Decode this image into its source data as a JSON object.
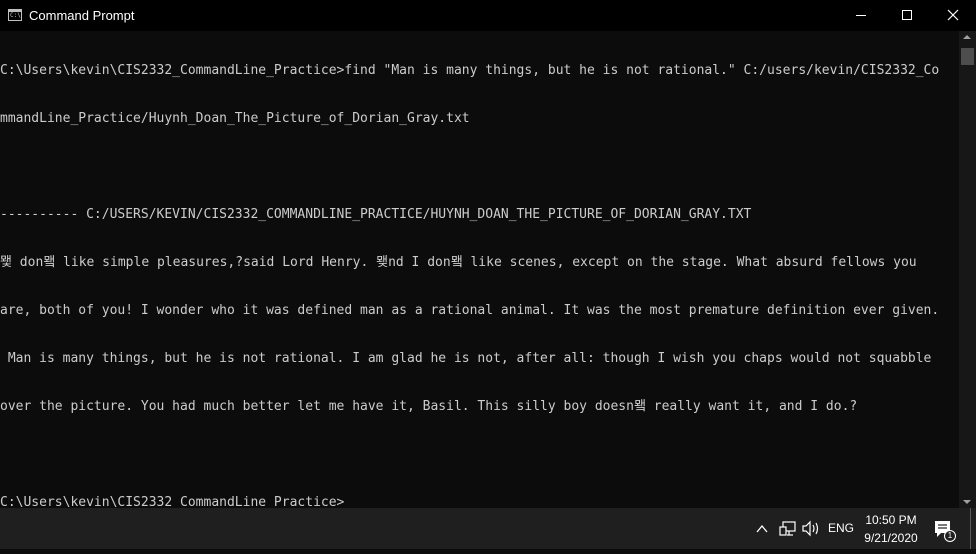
{
  "window": {
    "title": "Command Prompt",
    "app_icon_text": "C:\\",
    "icon": "cmd-icon"
  },
  "console": {
    "lines": [
      "C:\\Users\\kevin\\CIS2332_CommandLine_Practice>find \"Man is many things, but he is not rational.\" C:/users/kevin/CIS2332_Co",
      "mmandLine_Practice/Huynh_Doan_The_Picture_of_Dorian_Gray.txt",
      "",
      "---------- C:/USERS/KEVIN/CIS2332_COMMANDLINE_PRACTICE/HUYNH_DOAN_THE_PICTURE_OF_DORIAN_GRAY.TXT",
      "뫷 don뫸 like simple pleasures,?said Lord Henry. 뫶nd I don뫸 like scenes, except on the stage. What absurd fellows you",
      "are, both of you! I wonder who it was defined man as a rational animal. It was the most premature definition ever given.",
      " Man is many things, but he is not rational. I am glad he is not, after all: though I wish you chaps would not squabble",
      "over the picture. You had much better let me have it, Basil. This silly boy doesn뫸 really want it, and I do.?",
      "",
      "C:\\Users\\kevin\\CIS2332_CommandLine_Practice>"
    ]
  },
  "taskbar": {
    "language": "ENG",
    "time": "10:50 PM",
    "date": "9/21/2020",
    "notification_count": "1",
    "icons": [
      "chevron-up-icon",
      "network-icon",
      "volume-icon",
      "notification-icon"
    ]
  },
  "colors": {
    "console_bg": "#0c0c0c",
    "console_text": "#cccccc",
    "titlebar_bg": "#000000",
    "taskbar_bg": "#1f1f1f"
  }
}
